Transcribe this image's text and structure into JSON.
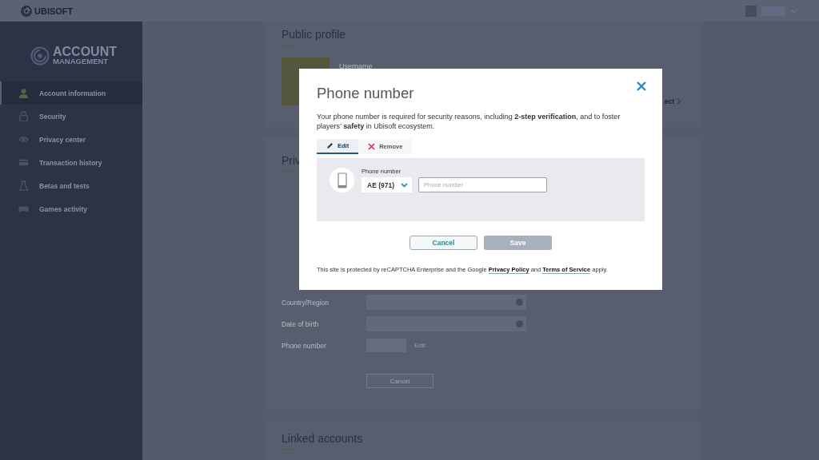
{
  "top_bar": {
    "brand": "UBISOFT"
  },
  "sidebar": {
    "logo_line_1": "ACCOUNT",
    "logo_line_2": "MANAGEMENT",
    "items": [
      {
        "label": "Account information",
        "kind": "person",
        "selected": true
      },
      {
        "label": "Security",
        "kind": "lock",
        "selected": false
      },
      {
        "label": "Privacy center",
        "kind": "eye",
        "selected": false
      },
      {
        "label": "Transaction history",
        "kind": "card",
        "selected": false
      },
      {
        "label": "Betas and tests",
        "kind": "flask",
        "selected": false
      },
      {
        "label": "Games activity",
        "kind": "gamepad",
        "selected": false
      }
    ]
  },
  "public_profile": {
    "title": "Public profile",
    "username_label": "Username",
    "link": "ect"
  },
  "private_section": {
    "title": "Priv",
    "rows": [
      {
        "label": "Country/Region",
        "kind": "field"
      },
      {
        "label": "Date of birth",
        "kind": "field"
      },
      {
        "label": "Phone number",
        "kind": "action",
        "action": "Edit"
      }
    ],
    "cancel": "Cancel"
  },
  "linked_accounts": {
    "title": "Linked accounts"
  },
  "modal": {
    "title": "Phone number",
    "intro": "Your phone number is required for security reasons, including **2-step verification**, and to foster players’ **safety** in Ubisoft ecosystem.",
    "tabs": [
      {
        "label": "Edit",
        "kind": "edit",
        "selected": true
      },
      {
        "label": "Remove",
        "kind": "remove",
        "selected": false
      }
    ],
    "field_label": "Phone number",
    "country_code": "AE (971)",
    "placeholder": "Phone number",
    "buttons": [
      {
        "label": "Cancel",
        "kind": "secondary",
        "disabled": false
      },
      {
        "label": "Save",
        "kind": "primary",
        "disabled": true
      }
    ],
    "footer": {
      "before": "This site is protected by reCAPTCHA Enterprise and the Google",
      "link_1": "Privacy Policy",
      "middle": "and",
      "link_2": "Terms of Service",
      "after": "apply."
    }
  }
}
